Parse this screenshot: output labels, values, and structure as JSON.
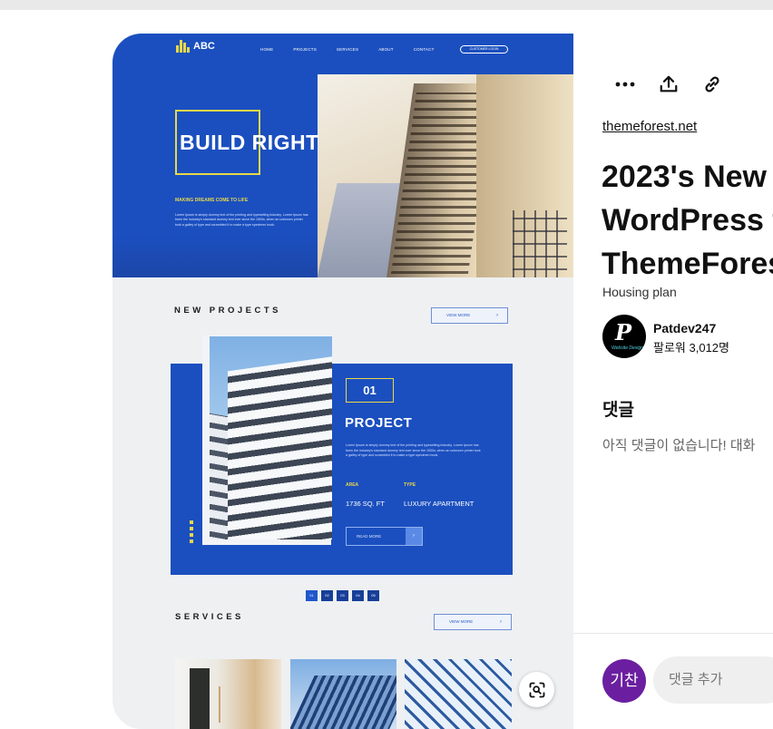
{
  "screen": {
    "background": "#ffffff"
  },
  "mockup": {
    "hero": {
      "logo": "ABC",
      "nav": [
        "HOME",
        "PROJECTS",
        "SERVICES",
        "ABOUT",
        "CONTACT"
      ],
      "cta": "CUSTOMER LOGIN",
      "title": "BUILD RIGHT",
      "tagline": "MAKING DREAMS COME TO LIFE",
      "copy": "Lorem Ipsum is simply dummy text of the printing and typesetting industry. Lorem Ipsum has been the industry's standard dummy text ever since the 1500s, when an unknown printer took a galley of type and scrambled it to make a type specimen book."
    },
    "new_projects": {
      "title": "NEW PROJECTS",
      "view_more": "VIEW MORE",
      "number": "01",
      "heading": "PROJECT",
      "copy": "Lorem Ipsum is simply dummy text of the printing and typesetting industry. Lorem Ipsum has been the industry's standard dummy text ever since the 1500s, when an unknown printer took a galley of type and scrambled it to make a type specimen book.",
      "area_label": "AREA",
      "area_value": "1736 SQ. FT",
      "type_label": "TYPE",
      "type_value": "LUXURY APARTMENT",
      "read_more": "READ MORE",
      "pages": [
        "01",
        "02",
        "03",
        "04",
        "05"
      ]
    },
    "services": {
      "title": "SERVICES",
      "view_more": "VIEW MORE"
    },
    "accent": "#1b4fbf",
    "highlight": "#e8d84a"
  },
  "actions": {
    "icons": [
      "more-icon",
      "share-icon",
      "link-icon"
    ]
  },
  "pin": {
    "source": "themeforest.net",
    "title_lines": [
      "2023's New",
      "WordPress t",
      "ThemeFores"
    ],
    "board": "Housing plan"
  },
  "author": {
    "name": "Patdev247",
    "followers": "팔로워 3,012명",
    "avatar_letter": "P",
    "avatar_script": "Website Design"
  },
  "comments": {
    "heading": "댓글",
    "empty": "아직 댓글이 없습니다! 대화"
  },
  "composer": {
    "avatar_initials": "기찬",
    "avatar_color": "#6b1fa0",
    "placeholder": "댓글 추가"
  }
}
